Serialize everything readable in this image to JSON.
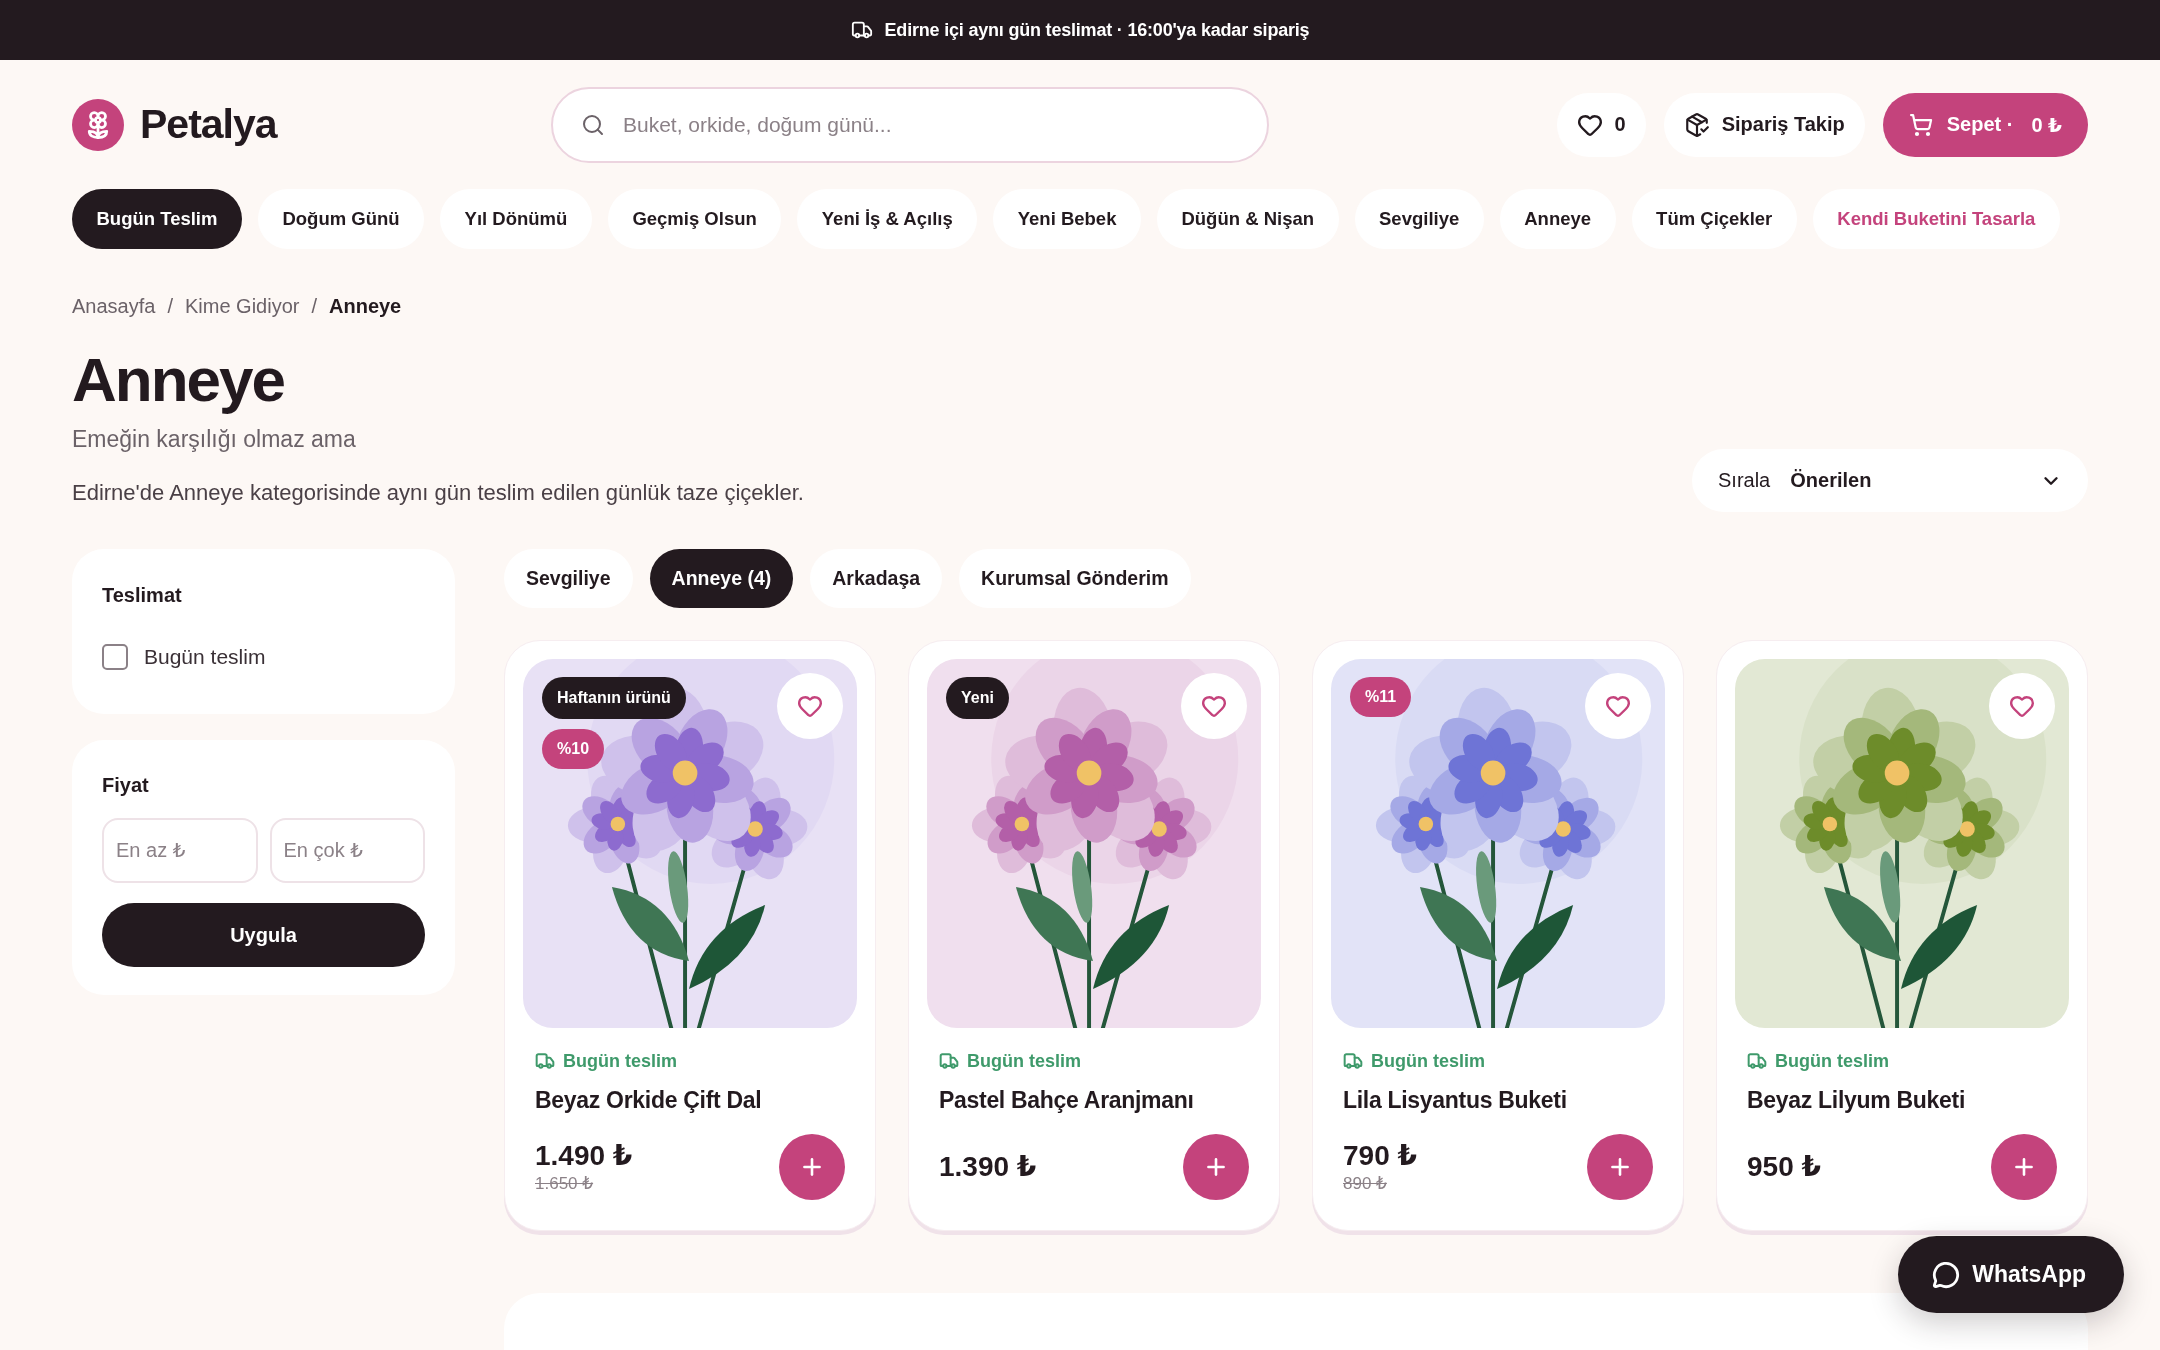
{
  "announcement": {
    "text": "Edirne içi aynı gün teslimat · 16:00'ya kadar sipariş"
  },
  "header": {
    "logo": "Petalya",
    "search": {
      "placeholder": "Buket, orkide, doğum günü..."
    },
    "favorites": {
      "count": "0"
    },
    "order_tracking": "Sipariş Takip",
    "cart": {
      "label": "Sepet ·",
      "total": "0 ₺"
    }
  },
  "nav": [
    {
      "label": "Bugün Teslim",
      "kind": "category",
      "selected": true
    },
    {
      "label": "Doğum Günü",
      "kind": "category",
      "selected": false
    },
    {
      "label": "Yıl Dönümü",
      "kind": "category",
      "selected": false
    },
    {
      "label": "Geçmiş Olsun",
      "kind": "category",
      "selected": false
    },
    {
      "label": "Yeni İş & Açılış",
      "kind": "category",
      "selected": false
    },
    {
      "label": "Yeni Bebek",
      "kind": "category",
      "selected": false
    },
    {
      "label": "Düğün & Nişan",
      "kind": "category",
      "selected": false
    },
    {
      "label": "Sevgiliye",
      "kind": "category",
      "selected": false
    },
    {
      "label": "Anneye",
      "kind": "category",
      "selected": false
    },
    {
      "label": "Tüm Çiçekler",
      "kind": "category",
      "selected": false
    },
    {
      "label": "Kendi Buketini Tasarla",
      "kind": "custom",
      "selected": false
    }
  ],
  "breadcrumb": {
    "separator": "/",
    "items": [
      {
        "label": "Anasayfa",
        "current": false
      },
      {
        "label": "Kime Gidiyor",
        "current": false
      },
      {
        "label": "Anneye",
        "current": true
      }
    ]
  },
  "page": {
    "title": "Anneye",
    "subtitle": "Emeğin karşılığı olmaz ama",
    "description": "Edirne'de Anneye kategorisinde aynı gün teslim edilen günlük taze çiçekler."
  },
  "sort": {
    "label": "Sırala",
    "value": "Önerilen"
  },
  "filters": {
    "delivery": {
      "title": "Teslimat",
      "options": [
        {
          "label": "Bugün teslim",
          "checked": false
        }
      ]
    },
    "price": {
      "title": "Fiyat",
      "min_placeholder": "En az ₺",
      "max_placeholder": "En çok ₺",
      "apply": "Uygula"
    }
  },
  "chips": [
    {
      "label": "Sevgiliye",
      "selected": false
    },
    {
      "label": "Anneye (4)",
      "selected": true
    },
    {
      "label": "Arkadaşa",
      "selected": false
    },
    {
      "label": "Kurumsal Gönderim",
      "selected": false
    }
  ],
  "products": [
    {
      "name": "Beyaz Orkide Çift Dal",
      "delivery": "Bugün teslim",
      "price": "1.490 ₺",
      "old_price": "1.650 ₺",
      "color": "#8d6bcf",
      "badges": [
        {
          "kind": "label",
          "text": "Haftanın ürünü"
        },
        {
          "kind": "discount",
          "text": "%10"
        }
      ]
    },
    {
      "name": "Pastel Bahçe Aranjmanı",
      "delivery": "Bugün teslim",
      "price": "1.390 ₺",
      "color": "#b35fa8",
      "badges": [
        {
          "kind": "label",
          "text": "Yeni"
        }
      ]
    },
    {
      "name": "Lila Lisyantus Buketi",
      "delivery": "Bugün teslim",
      "price": "790 ₺",
      "old_price": "890 ₺",
      "color": "#6e74d6",
      "badges": [
        {
          "kind": "discount",
          "text": "%11"
        }
      ]
    },
    {
      "name": "Beyaz Lilyum Buketi",
      "delivery": "Bugün teslim",
      "price": "950 ₺",
      "color": "#6d8c2a"
    }
  ],
  "whatsapp": "WhatsApp"
}
